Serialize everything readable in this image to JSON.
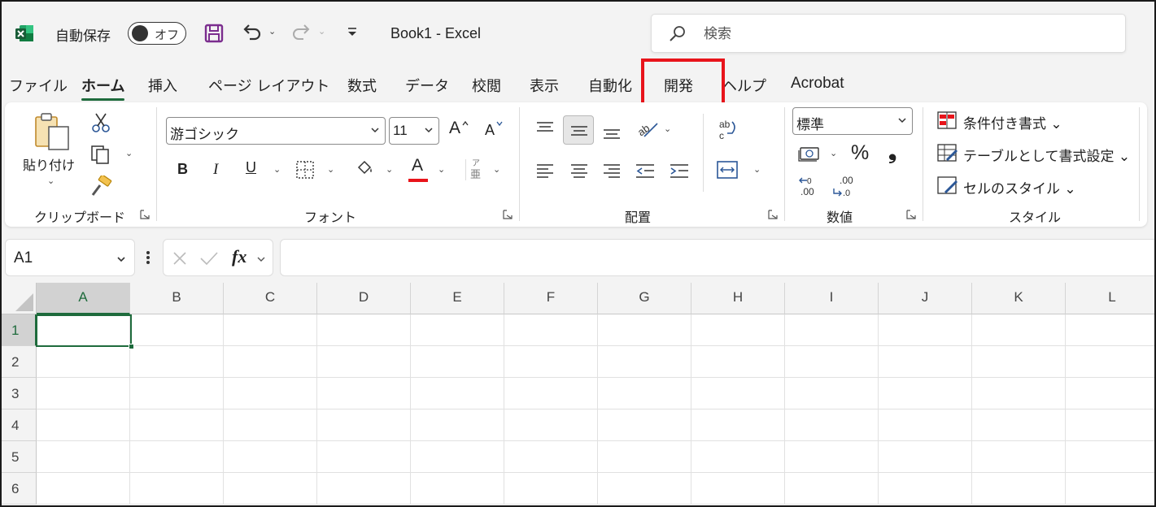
{
  "app": {
    "title": "Book1  -  Excel",
    "brand_color": "#1e6b3c",
    "highlight_color": "#e8141b"
  },
  "titlebar": {
    "autosave_label": "自動保存",
    "autosave_state": "オフ",
    "search_placeholder": "検索"
  },
  "tabs": [
    {
      "label": "ファイル",
      "active": false
    },
    {
      "label": "ホーム",
      "active": true
    },
    {
      "label": "挿入",
      "active": false
    },
    {
      "label": "ページ レイアウト",
      "active": false
    },
    {
      "label": "数式",
      "active": false
    },
    {
      "label": "データ",
      "active": false
    },
    {
      "label": "校閲",
      "active": false
    },
    {
      "label": "表示",
      "active": false
    },
    {
      "label": "自動化",
      "active": false
    },
    {
      "label": "開発",
      "active": false,
      "highlighted": true
    },
    {
      "label": "ヘルプ",
      "active": false
    },
    {
      "label": "Acrobat",
      "active": false
    }
  ],
  "ribbon": {
    "clipboard": {
      "label": "クリップボード",
      "paste_label": "貼り付け"
    },
    "font": {
      "label": "フォント",
      "font_name": "游ゴシック",
      "font_size": "11",
      "grow_letter": "A",
      "shrink_letter": "A",
      "bold": "B",
      "italic": "I",
      "underline": "U",
      "font_color_letter": "A",
      "font_color": "#e8141b",
      "phonetic_top": "ア",
      "phonetic_bottom": "亜"
    },
    "alignment": {
      "label": "配置"
    },
    "number": {
      "label": "数値",
      "format": "標準",
      "percent": "%",
      "comma": "❟"
    },
    "styles": {
      "label": "スタイル",
      "items": [
        "条件付き書式 ⌄",
        "テーブルとして書式設定 ⌄",
        "セルのスタイル ⌄"
      ]
    }
  },
  "formula_bar": {
    "name_box": "A1",
    "fx": "fx",
    "content": ""
  },
  "grid": {
    "columns": [
      "A",
      "B",
      "C",
      "D",
      "E",
      "F",
      "G",
      "H",
      "I",
      "J",
      "K",
      "L"
    ],
    "rows": [
      "1",
      "2",
      "3",
      "4",
      "5",
      "6"
    ],
    "selected_cell": "A1"
  }
}
